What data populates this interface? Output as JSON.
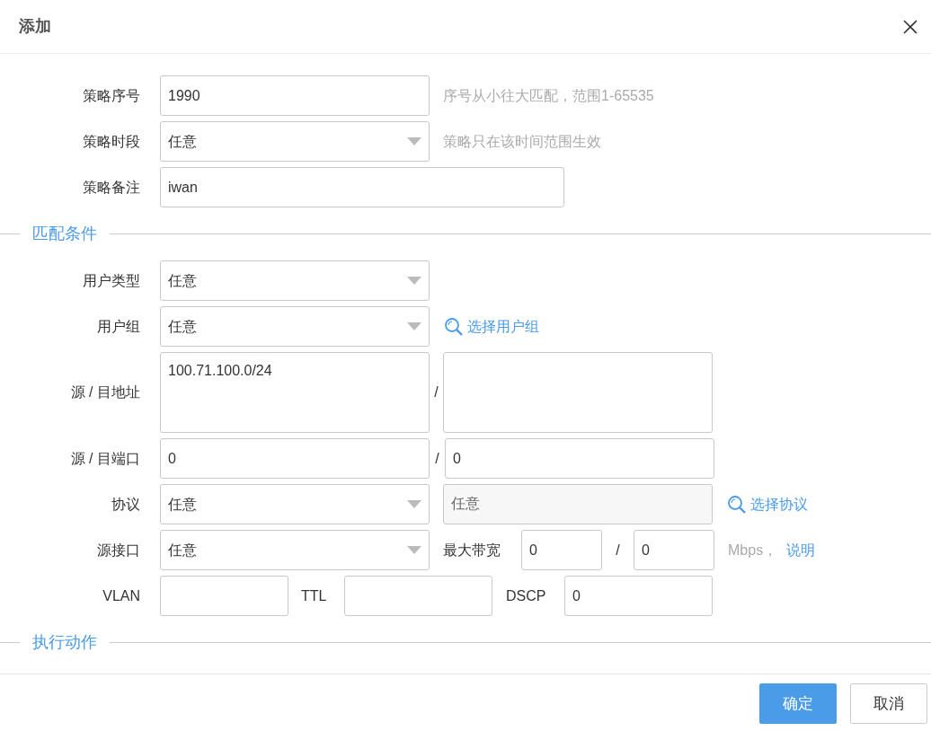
{
  "dialog_title": "添加",
  "policy_number": {
    "label": "策略序号",
    "value": "1990",
    "hint": "序号从小往大匹配，范围1-65535"
  },
  "policy_period": {
    "label": "策略时段",
    "value": "任意",
    "hint": "策略只在该时间范围生效"
  },
  "policy_note": {
    "label": "策略备注",
    "value": "iwan"
  },
  "match_section": {
    "title": "匹配条件"
  },
  "user_type": {
    "label": "用户类型",
    "value": "任意"
  },
  "user_group": {
    "label": "用户组",
    "value": "任意",
    "link": "选择用户组"
  },
  "address": {
    "label": "源 / 目地址",
    "source": "100.71.100.0/24",
    "separator": "/"
  },
  "port": {
    "label": "源 / 目端口",
    "source": "0",
    "separator": "/",
    "destination": "0"
  },
  "protocol": {
    "label": "协议",
    "value": "任意",
    "detail": "任意",
    "detail_disabled": true,
    "link": "选择协议"
  },
  "source_interface": {
    "label": "源接口",
    "value": "任意"
  },
  "max_bandwidth": {
    "label": "最大带宽",
    "upload": "0",
    "separator": "/",
    "download": "0",
    "unit": "Mbps，",
    "help_link": "说明"
  },
  "vlan": {
    "label": "VLAN"
  },
  "ttl": {
    "label": "TTL"
  },
  "dscp": {
    "label": "DSCP",
    "value": "0"
  },
  "action_section": {
    "title": "执行动作"
  },
  "buttons": [
    {
      "label": "确定",
      "kind": "primary"
    },
    {
      "label": "取消",
      "kind": "secondary"
    }
  ]
}
